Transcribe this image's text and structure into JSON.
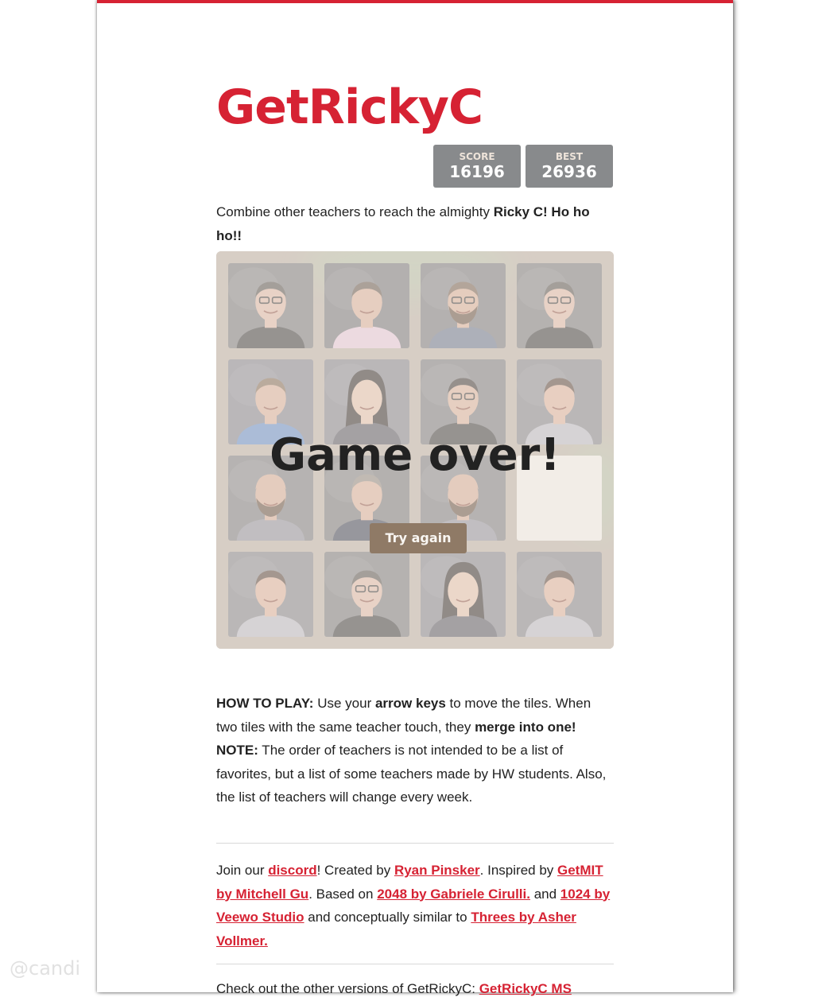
{
  "title": "GetRickyC",
  "scores": {
    "score_label": "SCORE",
    "score_value": "16196",
    "best_label": "BEST",
    "best_value": "26936"
  },
  "intro": {
    "text": "Combine other teachers to reach the almighty ",
    "bold": "Ricky C! Ho ho ho!!"
  },
  "board": {
    "game_over_text": "Game over!",
    "retry_label": "Try again",
    "tiles": [
      {
        "teacher": "glasses-man-gray-bg"
      },
      {
        "teacher": "man-pink-shirt"
      },
      {
        "teacher": "bearded-man-plaid"
      },
      {
        "teacher": "glasses-man-gray-bg"
      },
      {
        "teacher": "man-blue-shirt"
      },
      {
        "teacher": "woman-long-hair"
      },
      {
        "teacher": "woman-glasses"
      },
      {
        "teacher": "man-plaid-shirt"
      },
      {
        "teacher": "bald-bearded-man"
      },
      {
        "teacher": "man-dark-shirt"
      },
      {
        "teacher": "bald-bearded-man"
      },
      {
        "teacher": "empty"
      },
      {
        "teacher": "man-plaid-shirt"
      },
      {
        "teacher": "glasses-man-gray-bg"
      },
      {
        "teacher": "woman-long-hair"
      },
      {
        "teacher": "man-plaid-shirt"
      }
    ]
  },
  "howto": {
    "label": "HOW TO PLAY:",
    "text1": " Use your ",
    "bold1": "arrow keys",
    "text2": " to move the tiles. When two tiles with the same teacher touch, they ",
    "bold2": "merge into one!",
    "note_label": "NOTE:",
    "note_text": " The order of teachers is not intended to be a list of favorites, but a list of some teachers made by HW students. Also, the list of teachers will change every week."
  },
  "credits": {
    "t1": "Join our ",
    "discord": "discord",
    "t2": "! Created by ",
    "author": "Ryan Pinsker",
    "t3": ". Inspired by ",
    "getmit": "GetMIT by Mitchell Gu",
    "t4": ". Based on ",
    "g2048": "2048 by Gabriele Cirulli.",
    "t5": " and ",
    "g1024": "1024 by Veewo Studio",
    "t6": " and conceptually similar to ",
    "threes": "Threes by Asher Vollmer."
  },
  "more": {
    "text": "Check out the other versions of GetRickyC: ",
    "link": "GetRickyC MS"
  },
  "watermark": "@candi",
  "colors": {
    "accent": "#d62233",
    "board": "#bbada0",
    "button": "#8f7a66",
    "scorebox": "#888a8c"
  }
}
